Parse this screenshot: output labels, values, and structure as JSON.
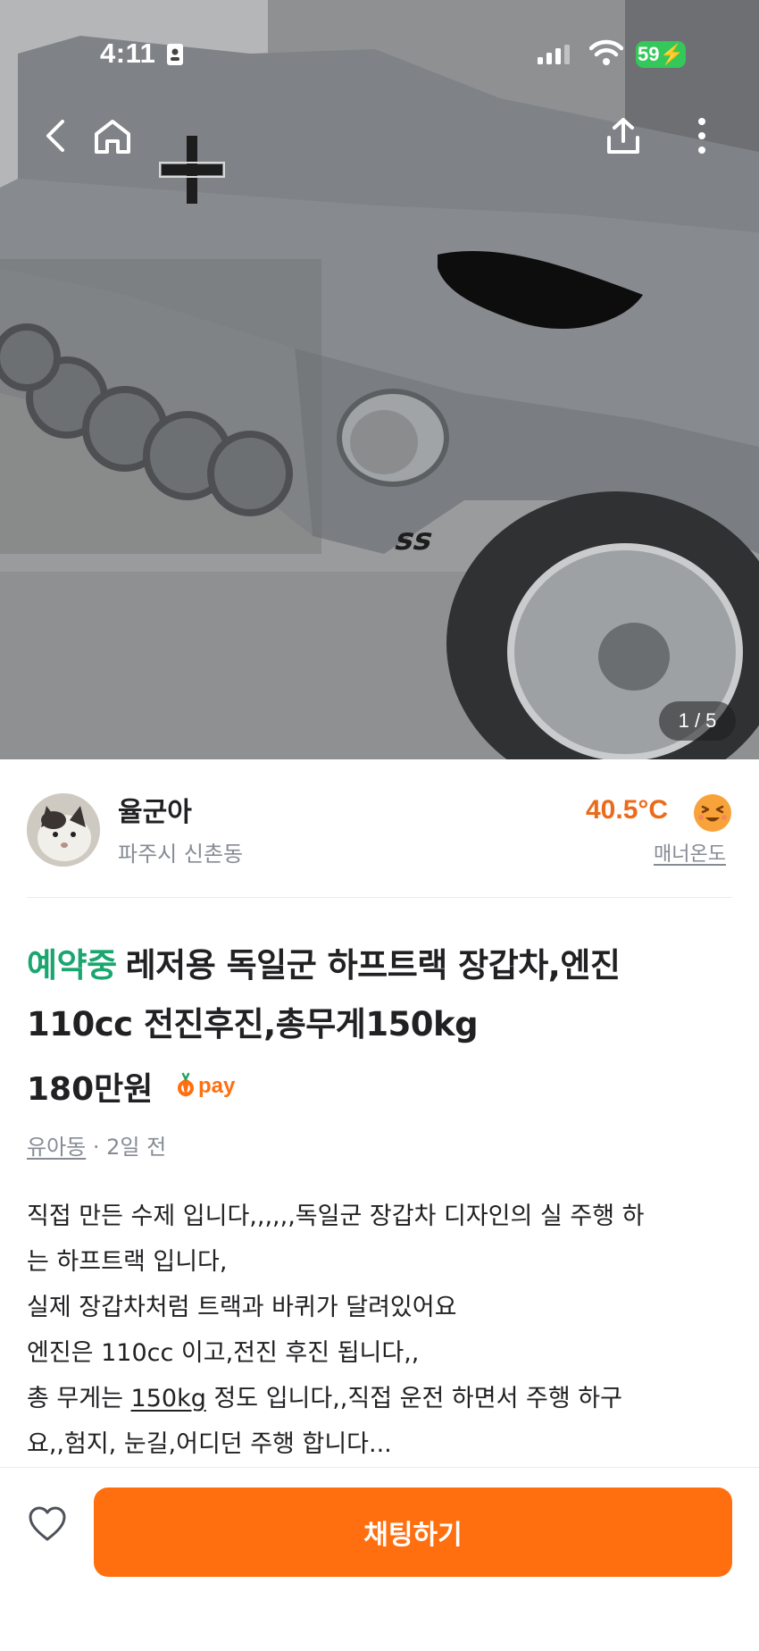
{
  "status_bar": {
    "time": "4:11",
    "battery": "59"
  },
  "photo": {
    "counter": "1 / 5"
  },
  "seller": {
    "name": "율군아",
    "location": "파주시 신촌동",
    "temperature": "40.5°C",
    "manner_label": "매너온도"
  },
  "listing": {
    "status_badge": "예약중",
    "title_line1": "레저용 독일군 하프트랙 장갑차,엔진",
    "title_line2": "110cc 전진후진,총무게150kg",
    "price": "180만원",
    "pay_label": "pay",
    "category": "유아동",
    "separator": " · ",
    "posted": "2일 전",
    "description": {
      "line1": "직접 만든 수제 입니다,,,,,,독일군 장갑차 디자인의 실 주행 하",
      "line2": "는 하프트랙 입니다,",
      "line3": "실제 장갑차처럼 트랙과 바퀴가 달려있어요",
      "line4": "엔진은 110cc 이고,전진 후진 됩니다,,",
      "line5_a": "총 무게는 ",
      "line5_b": "150kg",
      "line5_c": " 정도 입니다,,직접 운전 하면서 주행 하구",
      "line6": "요,,험지, 눈길,어디던 주행 합니다..."
    }
  },
  "bottom_bar": {
    "chat_label": "채팅하기"
  },
  "colors": {
    "accent": "#ff6f0f",
    "reserved": "#1ba66f",
    "temperature": "#ec6b1b",
    "muted": "#868b94"
  },
  "icons": [
    "back-icon",
    "home-icon",
    "share-icon",
    "more-icon",
    "heart-icon",
    "wifi-icon",
    "signal-icon",
    "id-card-icon",
    "smile-face-icon",
    "carrot-icon"
  ]
}
